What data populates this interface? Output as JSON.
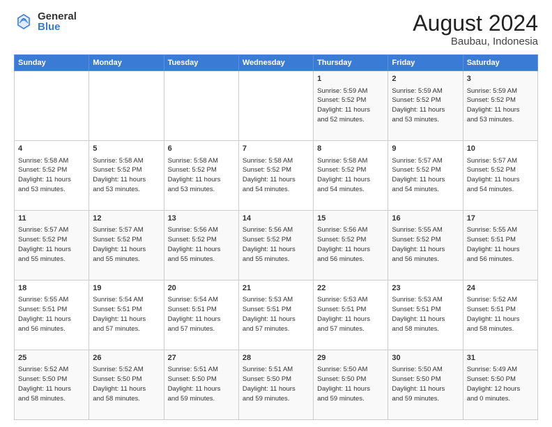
{
  "logo": {
    "general": "General",
    "blue": "Blue"
  },
  "header": {
    "month": "August 2024",
    "location": "Baubau, Indonesia"
  },
  "days_of_week": [
    "Sunday",
    "Monday",
    "Tuesday",
    "Wednesday",
    "Thursday",
    "Friday",
    "Saturday"
  ],
  "weeks": [
    [
      {
        "day": "",
        "info": ""
      },
      {
        "day": "",
        "info": ""
      },
      {
        "day": "",
        "info": ""
      },
      {
        "day": "",
        "info": ""
      },
      {
        "day": "1",
        "info": "Sunrise: 5:59 AM\nSunset: 5:52 PM\nDaylight: 11 hours\nand 52 minutes."
      },
      {
        "day": "2",
        "info": "Sunrise: 5:59 AM\nSunset: 5:52 PM\nDaylight: 11 hours\nand 53 minutes."
      },
      {
        "day": "3",
        "info": "Sunrise: 5:59 AM\nSunset: 5:52 PM\nDaylight: 11 hours\nand 53 minutes."
      }
    ],
    [
      {
        "day": "4",
        "info": "Sunrise: 5:58 AM\nSunset: 5:52 PM\nDaylight: 11 hours\nand 53 minutes."
      },
      {
        "day": "5",
        "info": "Sunrise: 5:58 AM\nSunset: 5:52 PM\nDaylight: 11 hours\nand 53 minutes."
      },
      {
        "day": "6",
        "info": "Sunrise: 5:58 AM\nSunset: 5:52 PM\nDaylight: 11 hours\nand 53 minutes."
      },
      {
        "day": "7",
        "info": "Sunrise: 5:58 AM\nSunset: 5:52 PM\nDaylight: 11 hours\nand 54 minutes."
      },
      {
        "day": "8",
        "info": "Sunrise: 5:58 AM\nSunset: 5:52 PM\nDaylight: 11 hours\nand 54 minutes."
      },
      {
        "day": "9",
        "info": "Sunrise: 5:57 AM\nSunset: 5:52 PM\nDaylight: 11 hours\nand 54 minutes."
      },
      {
        "day": "10",
        "info": "Sunrise: 5:57 AM\nSunset: 5:52 PM\nDaylight: 11 hours\nand 54 minutes."
      }
    ],
    [
      {
        "day": "11",
        "info": "Sunrise: 5:57 AM\nSunset: 5:52 PM\nDaylight: 11 hours\nand 55 minutes."
      },
      {
        "day": "12",
        "info": "Sunrise: 5:57 AM\nSunset: 5:52 PM\nDaylight: 11 hours\nand 55 minutes."
      },
      {
        "day": "13",
        "info": "Sunrise: 5:56 AM\nSunset: 5:52 PM\nDaylight: 11 hours\nand 55 minutes."
      },
      {
        "day": "14",
        "info": "Sunrise: 5:56 AM\nSunset: 5:52 PM\nDaylight: 11 hours\nand 55 minutes."
      },
      {
        "day": "15",
        "info": "Sunrise: 5:56 AM\nSunset: 5:52 PM\nDaylight: 11 hours\nand 56 minutes."
      },
      {
        "day": "16",
        "info": "Sunrise: 5:55 AM\nSunset: 5:52 PM\nDaylight: 11 hours\nand 56 minutes."
      },
      {
        "day": "17",
        "info": "Sunrise: 5:55 AM\nSunset: 5:51 PM\nDaylight: 11 hours\nand 56 minutes."
      }
    ],
    [
      {
        "day": "18",
        "info": "Sunrise: 5:55 AM\nSunset: 5:51 PM\nDaylight: 11 hours\nand 56 minutes."
      },
      {
        "day": "19",
        "info": "Sunrise: 5:54 AM\nSunset: 5:51 PM\nDaylight: 11 hours\nand 57 minutes."
      },
      {
        "day": "20",
        "info": "Sunrise: 5:54 AM\nSunset: 5:51 PM\nDaylight: 11 hours\nand 57 minutes."
      },
      {
        "day": "21",
        "info": "Sunrise: 5:53 AM\nSunset: 5:51 PM\nDaylight: 11 hours\nand 57 minutes."
      },
      {
        "day": "22",
        "info": "Sunrise: 5:53 AM\nSunset: 5:51 PM\nDaylight: 11 hours\nand 57 minutes."
      },
      {
        "day": "23",
        "info": "Sunrise: 5:53 AM\nSunset: 5:51 PM\nDaylight: 11 hours\nand 58 minutes."
      },
      {
        "day": "24",
        "info": "Sunrise: 5:52 AM\nSunset: 5:51 PM\nDaylight: 11 hours\nand 58 minutes."
      }
    ],
    [
      {
        "day": "25",
        "info": "Sunrise: 5:52 AM\nSunset: 5:50 PM\nDaylight: 11 hours\nand 58 minutes."
      },
      {
        "day": "26",
        "info": "Sunrise: 5:52 AM\nSunset: 5:50 PM\nDaylight: 11 hours\nand 58 minutes."
      },
      {
        "day": "27",
        "info": "Sunrise: 5:51 AM\nSunset: 5:50 PM\nDaylight: 11 hours\nand 59 minutes."
      },
      {
        "day": "28",
        "info": "Sunrise: 5:51 AM\nSunset: 5:50 PM\nDaylight: 11 hours\nand 59 minutes."
      },
      {
        "day": "29",
        "info": "Sunrise: 5:50 AM\nSunset: 5:50 PM\nDaylight: 11 hours\nand 59 minutes."
      },
      {
        "day": "30",
        "info": "Sunrise: 5:50 AM\nSunset: 5:50 PM\nDaylight: 11 hours\nand 59 minutes."
      },
      {
        "day": "31",
        "info": "Sunrise: 5:49 AM\nSunset: 5:50 PM\nDaylight: 12 hours\nand 0 minutes."
      }
    ]
  ]
}
